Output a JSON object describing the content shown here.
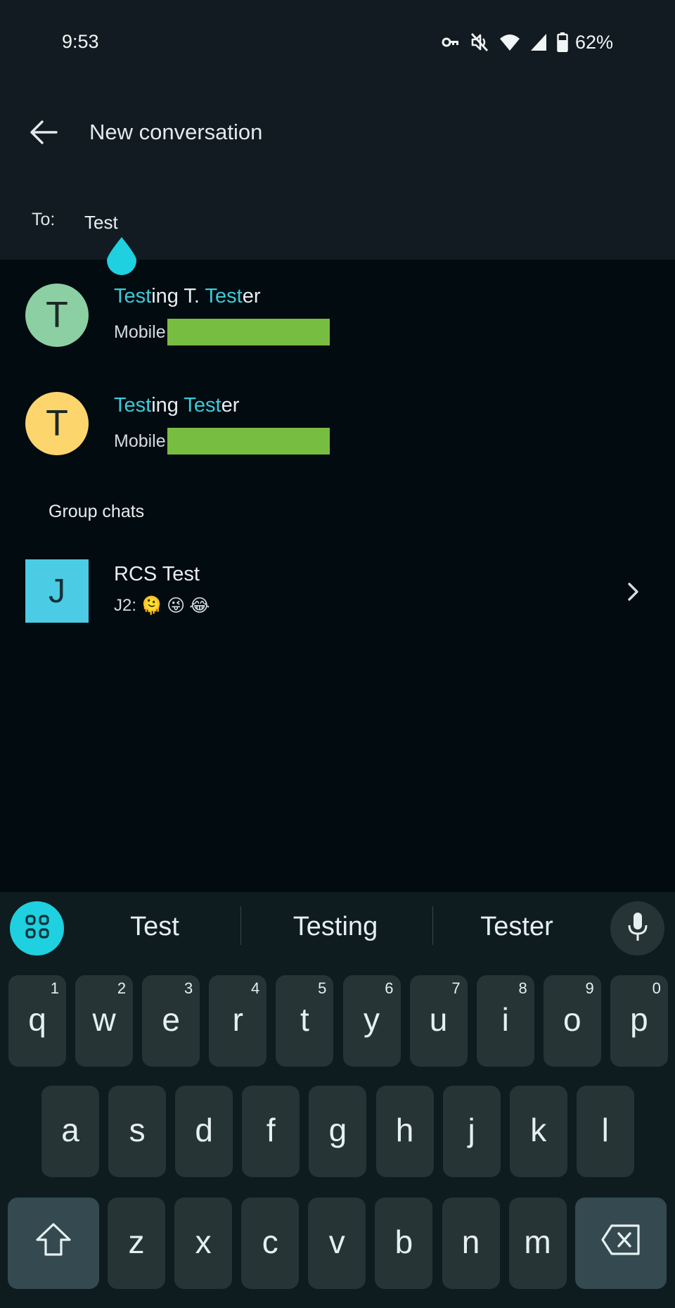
{
  "status_bar": {
    "time": "9:53",
    "icons": [
      "vpn-key-icon",
      "vibrate-off-icon",
      "wifi-icon",
      "cell-signal-icon",
      "battery-icon"
    ],
    "battery_percent": "62%"
  },
  "app_bar": {
    "back_icon": "arrow-back-icon",
    "title": "New conversation"
  },
  "recipient": {
    "label": "To:",
    "value": "Test"
  },
  "contacts": [
    {
      "initial": "T",
      "avatar_color": "#8ccfa3",
      "name_parts": [
        {
          "text": "Test",
          "hl": true
        },
        {
          "text": "ing T. ",
          "hl": false
        },
        {
          "text": "Test",
          "hl": true
        },
        {
          "text": "er",
          "hl": false
        }
      ],
      "name": "Testing T. Tester",
      "phone_label": "Mobile",
      "phone_redacted_color": "#77bd41"
    },
    {
      "initial": "T",
      "avatar_color": "#fdd56d",
      "name_parts": [
        {
          "text": "Test",
          "hl": true
        },
        {
          "text": "ing ",
          "hl": false
        },
        {
          "text": "Test",
          "hl": true
        },
        {
          "text": "er",
          "hl": false
        }
      ],
      "name": "Testing Tester",
      "phone_label": "Mobile",
      "phone_redacted_color": "#77bd41"
    }
  ],
  "group_section": {
    "title": "Group chats",
    "items": [
      {
        "initial": "J",
        "avatar_color": "#4ccbe4",
        "name": "RCS Test",
        "snippet_sender": "J2:",
        "snippet_emojis": [
          "🫠",
          "😜",
          "😂"
        ]
      }
    ]
  },
  "keyboard": {
    "suggestions": [
      "Test",
      "Testing",
      "Tester"
    ],
    "accent_color": "#1fd0e0",
    "row1": [
      {
        "key": "q",
        "num": "1"
      },
      {
        "key": "w",
        "num": "2"
      },
      {
        "key": "e",
        "num": "3"
      },
      {
        "key": "r",
        "num": "4"
      },
      {
        "key": "t",
        "num": "5"
      },
      {
        "key": "y",
        "num": "6"
      },
      {
        "key": "u",
        "num": "7"
      },
      {
        "key": "i",
        "num": "8"
      },
      {
        "key": "o",
        "num": "9"
      },
      {
        "key": "p",
        "num": "0"
      }
    ],
    "row2": [
      "a",
      "s",
      "d",
      "f",
      "g",
      "h",
      "j",
      "k",
      "l"
    ],
    "row3": [
      "z",
      "x",
      "c",
      "v",
      "b",
      "n",
      "m"
    ],
    "shift_icon": "shift-icon",
    "backspace_icon": "backspace-icon"
  }
}
